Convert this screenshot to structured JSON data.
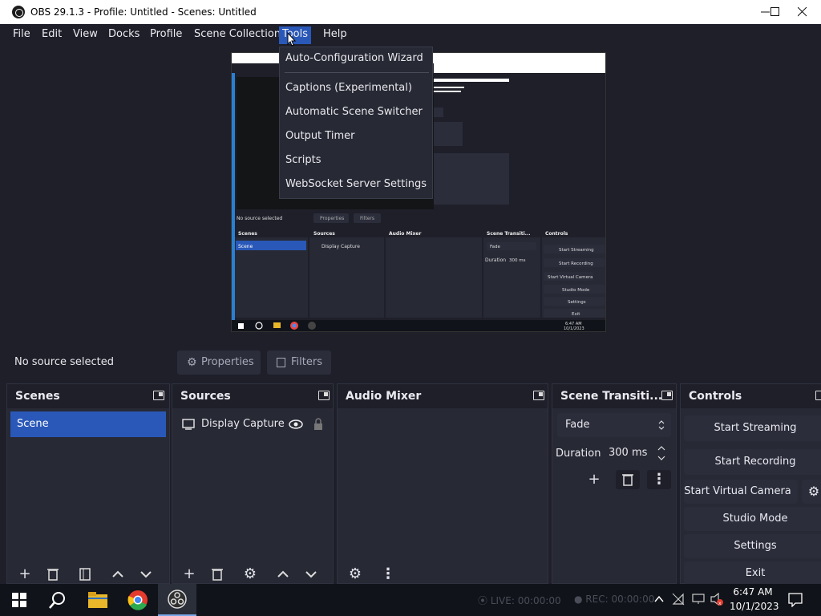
{
  "window": {
    "title": "OBS 29.1.3 - Profile: Untitled - Scenes: Untitled"
  },
  "menubar": {
    "items": [
      "File",
      "Edit",
      "View",
      "Docks",
      "Profile",
      "Scene Collection",
      "Tools",
      "Help"
    ]
  },
  "tools_menu": {
    "items": [
      "Auto-Configuration Wizard",
      "Captions (Experimental)",
      "Automatic Scene Switcher",
      "Output Timer",
      "Scripts",
      "WebSocket Server Settings"
    ]
  },
  "preview": {
    "mini_source_selected": "No source selected",
    "mini_properties": "Properties",
    "mini_filters": "Filters",
    "mini_docks": [
      "Scenes",
      "Sources",
      "Audio Mixer",
      "Scene Transiti...",
      "Controls"
    ],
    "mini_scene": "Scene",
    "mini_source": "Display Capture",
    "mini_fade": "Fade",
    "mini_duration_label": "Duration",
    "mini_duration": "300 ms",
    "mini_controls": [
      "Start Streaming",
      "Start Recording",
      "Start Virtual Camera",
      "Studio Mode",
      "Settings",
      "Exit"
    ],
    "mini_time": "6:47 AM",
    "mini_date": "10/1/2023"
  },
  "properties_bar": {
    "status": "No source selected",
    "properties_label": "Properties",
    "filters_label": "Filters"
  },
  "scenes": {
    "title": "Scenes",
    "items": [
      "Scene"
    ]
  },
  "sources": {
    "title": "Sources",
    "items": [
      "Display Capture"
    ]
  },
  "audio_mixer": {
    "title": "Audio Mixer"
  },
  "transitions": {
    "title": "Scene Transiti...",
    "selected": "Fade",
    "duration_label": "Duration",
    "duration_value": "300 ms"
  },
  "controls": {
    "title": "Controls",
    "start_streaming": "Start Streaming",
    "start_recording": "Start Recording",
    "start_virtual_camera": "Start Virtual Camera",
    "studio_mode": "Studio Mode",
    "settings": "Settings",
    "exit": "Exit"
  },
  "statusbar": {
    "live": "LIVE: 00:00:00",
    "rec": "REC: 00:00:00"
  },
  "taskbar": {
    "time": "6:47 AM",
    "date": "10/1/2023",
    "badge": "x"
  },
  "colors": {
    "accent": "#2a58b8",
    "panel": "#272935",
    "background": "#1e1f29",
    "taskbar": "#101319"
  }
}
